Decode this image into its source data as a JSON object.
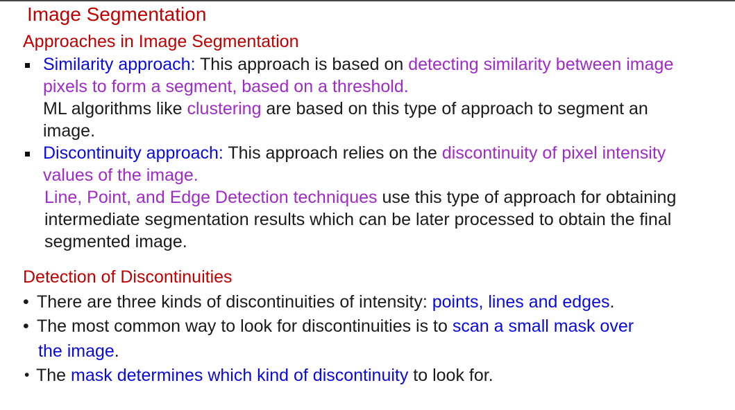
{
  "slide": {
    "title": "Image Segmentation"
  },
  "section1": {
    "heading": "Approaches in Image Segmentation",
    "items": [
      {
        "term": "Similarity approach:",
        "intro": " This approach is based on ",
        "highlight_line1": "detecting similarity between image",
        "highlight_line2": "pixels to form a segment, based on a threshold.",
        "note_prefix": "ML algorithms like ",
        "note_highlight": "clustering",
        "note_suffix": " are based on this type of approach to segment an",
        "note_line2": "image."
      },
      {
        "term": "Discontinuity approach:",
        "intro": " This approach relies on the ",
        "highlight_line1": "discontinuity of pixel intensity",
        "highlight_line2": "values of the image.",
        "note_highlight": "Line, Point, and Edge Detection techniques",
        "note_suffix": " use this type of approach for obtaining",
        "note_line2": "intermediate segmentation results which can be later processed to obtain the final",
        "note_line3": "segmented image."
      }
    ]
  },
  "section2": {
    "heading": "Detection of Discontinuities",
    "bullets": [
      {
        "prefix": "There are three kinds of discontinuities of intensity: ",
        "highlight": "points, lines and edges",
        "suffix": "."
      },
      {
        "prefix": "The most common way to look for discontinuities is to ",
        "highlight_line1": "scan a small mask over",
        "highlight_line2": "the image",
        "suffix": "."
      },
      {
        "prefix": "The ",
        "highlight": "mask determines which kind of discontinuity",
        "suffix": " to look for."
      }
    ]
  },
  "colors": {
    "heading": "#c00000",
    "term": "#0a0adc",
    "highlight": "#a02bc9",
    "text": "#1a1a1a"
  }
}
